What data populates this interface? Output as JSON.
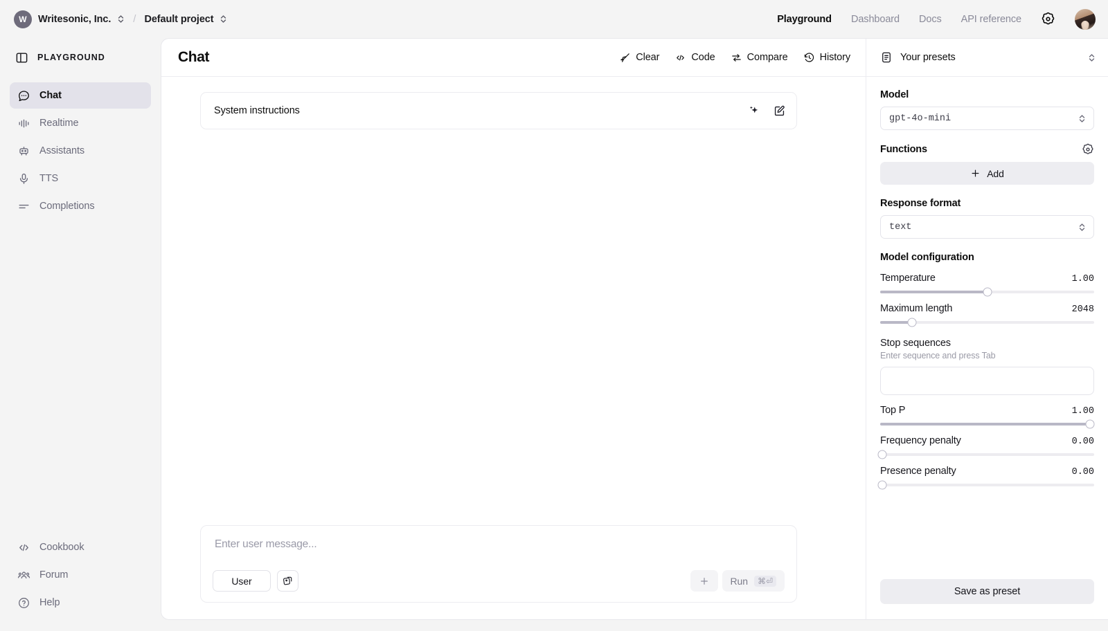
{
  "topbar": {
    "org_initial": "W",
    "org_name": "Writesonic, Inc.",
    "separator": "/",
    "project_name": "Default project",
    "nav": [
      {
        "label": "Playground",
        "active": true
      },
      {
        "label": "Dashboard",
        "active": false
      },
      {
        "label": "Docs",
        "active": false
      },
      {
        "label": "API reference",
        "active": false
      }
    ],
    "settings_icon": "gear-icon",
    "avatar": "user-avatar"
  },
  "sidebar": {
    "header_label": "PLAYGROUND",
    "header_icon": "panel-left-icon",
    "items": [
      {
        "label": "Chat",
        "icon": "chat-bubble-icon",
        "active": true
      },
      {
        "label": "Realtime",
        "icon": "waveform-icon",
        "active": false
      },
      {
        "label": "Assistants",
        "icon": "robot-icon",
        "active": false
      },
      {
        "label": "TTS",
        "icon": "microphone-icon",
        "active": false
      },
      {
        "label": "Completions",
        "icon": "lines-icon",
        "active": false
      }
    ],
    "bottom_items": [
      {
        "label": "Cookbook",
        "icon": "code-brackets-icon"
      },
      {
        "label": "Forum",
        "icon": "people-icon"
      },
      {
        "label": "Help",
        "icon": "question-circle-icon"
      }
    ]
  },
  "main": {
    "title": "Chat",
    "actions": [
      {
        "label": "Clear",
        "icon": "broom-icon"
      },
      {
        "label": "Code",
        "icon": "code-brackets-icon"
      },
      {
        "label": "Compare",
        "icon": "compare-arrows-icon"
      },
      {
        "label": "History",
        "icon": "clock-history-icon"
      }
    ],
    "system_card": {
      "label": "System instructions",
      "sparkle_icon": "sparkle-icon",
      "edit_icon": "edit-pencil-icon"
    },
    "composer": {
      "placeholder": "Enter user message...",
      "role_label": "User",
      "attach_icon": "images-stack-icon",
      "add_label": "+",
      "run_label": "Run",
      "run_shortcut": "⌘⏎"
    }
  },
  "right": {
    "presets_label": "Your presets",
    "presets_icon": "preset-list-icon",
    "model_label": "Model",
    "model_value": "gpt-4o-mini",
    "functions_label": "Functions",
    "functions_gear_icon": "gear-icon",
    "add_label": "Add",
    "response_format_label": "Response format",
    "response_format_value": "text",
    "model_config_label": "Model configuration",
    "sliders": [
      {
        "name": "Temperature",
        "value": "1.00",
        "percent": 50
      },
      {
        "name": "Maximum length",
        "value": "2048",
        "percent": 15
      }
    ],
    "stop_sequences": {
      "title": "Stop sequences",
      "hint": "Enter sequence and press Tab",
      "value": ""
    },
    "sliders2": [
      {
        "name": "Top P",
        "value": "1.00",
        "percent": 98
      },
      {
        "name": "Frequency penalty",
        "value": "0.00",
        "percent": 1
      },
      {
        "name": "Presence penalty",
        "value": "0.00",
        "percent": 1
      }
    ],
    "save_label": "Save as preset"
  },
  "colors": {
    "page_bg": "#f4f4f4",
    "panel_bg": "#ffffff",
    "active_nav_bg": "#e3e2ea",
    "muted_text": "#8a8a99",
    "slider_fill": "#b9b8c6",
    "button_bg": "#ededf1"
  }
}
